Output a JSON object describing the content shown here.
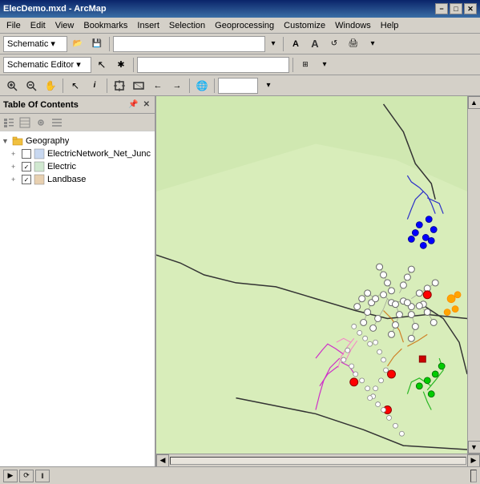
{
  "titlebar": {
    "title": "ElecDemo.mxd - ArcMap",
    "min_btn": "−",
    "max_btn": "□",
    "close_btn": "✕"
  },
  "menubar": {
    "items": [
      "File",
      "Edit",
      "View",
      "Bookmarks",
      "Insert",
      "Selection",
      "Geoprocessing",
      "Customize",
      "Windows",
      "Help"
    ]
  },
  "toolbar1": {
    "schematic_label": "Schematic ▾",
    "dropdown_placeholder": ""
  },
  "toolbar2": {
    "schematic_editor_label": "Schematic Editor ▾"
  },
  "toolbar3": {
    "tools": [
      "↖",
      "✋",
      "🔍",
      "🔍−",
      "⊕",
      "↩",
      "↪",
      "🌐",
      "⊞",
      "⊠"
    ]
  },
  "toc": {
    "title": "Table Of Contents",
    "layers": [
      {
        "name": "Geography",
        "type": "group",
        "expanded": true,
        "children": [
          {
            "name": "ElectricNetwork_Net_Junc",
            "type": "layer",
            "checked": false,
            "truncated": true
          },
          {
            "name": "Electric",
            "type": "layer",
            "checked": true
          },
          {
            "name": "Landbase",
            "type": "layer",
            "checked": true
          }
        ]
      }
    ]
  },
  "statusbar": {
    "icons": [
      "▶",
      "⟳",
      "‖"
    ],
    "zoom_label": "",
    "coord_label": ""
  },
  "icons": {
    "folder": "📁",
    "layer_group": "🗂",
    "layer": "▤",
    "checked": "✓",
    "expand": "+",
    "collapse": "−",
    "arrow_up": "▲",
    "arrow_down": "▼",
    "arrow_left": "◀",
    "arrow_right": "▶"
  }
}
